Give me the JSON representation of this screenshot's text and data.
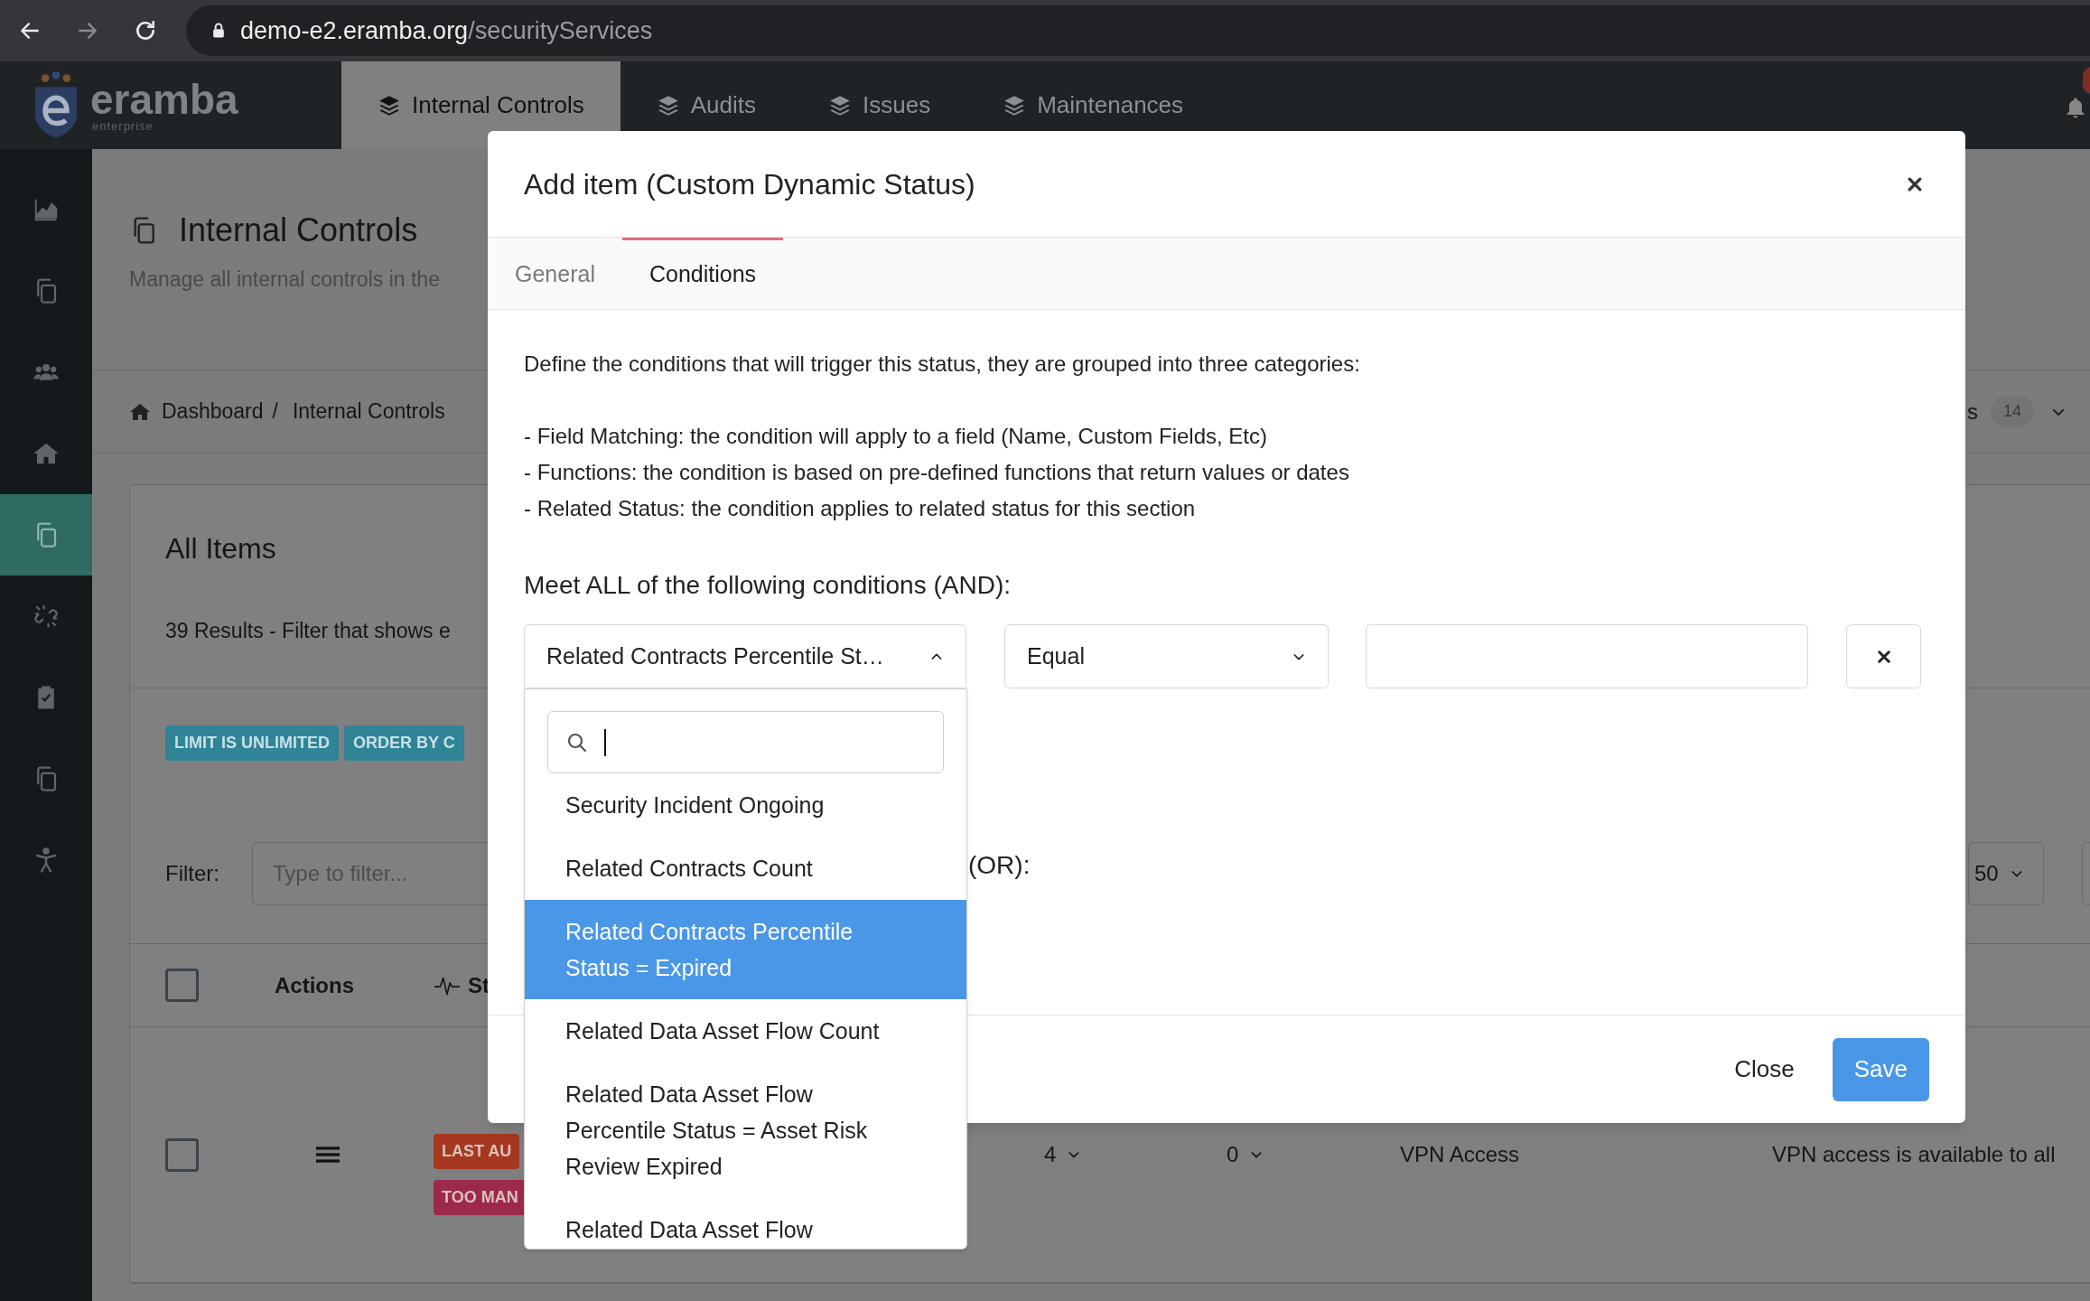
{
  "browser": {
    "url_host": "demo-e2.eramba.org",
    "url_path": "/securityServices"
  },
  "app_header": {
    "logo": "eramba",
    "logo_tagline": "enterprise",
    "tabs": [
      {
        "label": "Internal Controls",
        "selected": true
      },
      {
        "label": "Audits",
        "selected": false
      },
      {
        "label": "Issues",
        "selected": false
      },
      {
        "label": "Maintenances",
        "selected": false
      }
    ]
  },
  "sidebar": {
    "items": [
      {
        "selected": false
      },
      {
        "selected": false
      },
      {
        "selected": false
      },
      {
        "selected": false
      },
      {
        "selected": true
      },
      {
        "selected": false
      },
      {
        "selected": false
      },
      {
        "selected": false
      },
      {
        "selected": false
      }
    ]
  },
  "page": {
    "title": "Internal Controls",
    "subtitle": "Manage all internal controls in the",
    "breadcrumb": [
      "Dashboard",
      "Internal Controls"
    ],
    "breadcrumb_separator": "/",
    "filters_label": "s",
    "filters_count": "14",
    "card": {
      "title": "All Items",
      "summary": "39 Results - Filter that shows e",
      "tags": [
        "LIMIT IS UNLIMITED",
        "ORDER BY C"
      ],
      "filter_label": "Filter:",
      "filter_placeholder": "Type to filter...",
      "page_size": "50",
      "table": {
        "select_all_checked": false,
        "columns": [
          "Actions",
          "St"
        ],
        "rows": [
          {
            "checked": false,
            "badges": [
              {
                "label": "LAST AU",
                "color": "#a5381f"
              },
              {
                "label": "TOO MAN",
                "color": "#9c2b4b"
              }
            ],
            "cells": [
              {
                "kind": "count",
                "text": "4"
              },
              {
                "kind": "count",
                "text": "0"
              },
              {
                "kind": "text",
                "text": "VPN Access"
              },
              {
                "kind": "text",
                "text": "VPN access is available to all"
              }
            ]
          }
        ]
      }
    }
  },
  "modal": {
    "title": "Add item (Custom Dynamic Status)",
    "tabs": [
      {
        "label": "General",
        "selected": false
      },
      {
        "label": "Conditions",
        "selected": true
      }
    ],
    "intro": "Define the conditions that will trigger this status, they are grouped into three categories:",
    "bullets": [
      "- Field Matching: the condition will apply to a field (Name, Custom Fields, Etc)",
      "- Functions: the condition is based on pre-defined functions that return values or dates",
      "- Related Status: the condition applies to related status for this section"
    ],
    "all_heading": "Meet ALL of the following conditions (AND):",
    "condition": {
      "field": "Related Contracts Percentile St…",
      "operator": "Equal"
    },
    "field_dropdown": {
      "expanded": true,
      "options": [
        {
          "label": "Security Incident Ongoing",
          "selected": false
        },
        {
          "label": "Related Contracts Count",
          "selected": false
        },
        {
          "label": "Related Contracts Percentile Status = Expired",
          "selected": true
        },
        {
          "label": "Related Data Asset Flow Count",
          "selected": false
        },
        {
          "label": "Related Data Asset Flow Percentile Status = Asset Risk Review Expired",
          "selected": false
        },
        {
          "label": "Related Data Asset Flow",
          "selected": false
        }
      ]
    },
    "any_heading": "(OR):",
    "buttons": [
      {
        "label": "Close",
        "kind": "plain"
      },
      {
        "label": "Save",
        "kind": "primary"
      }
    ]
  }
}
